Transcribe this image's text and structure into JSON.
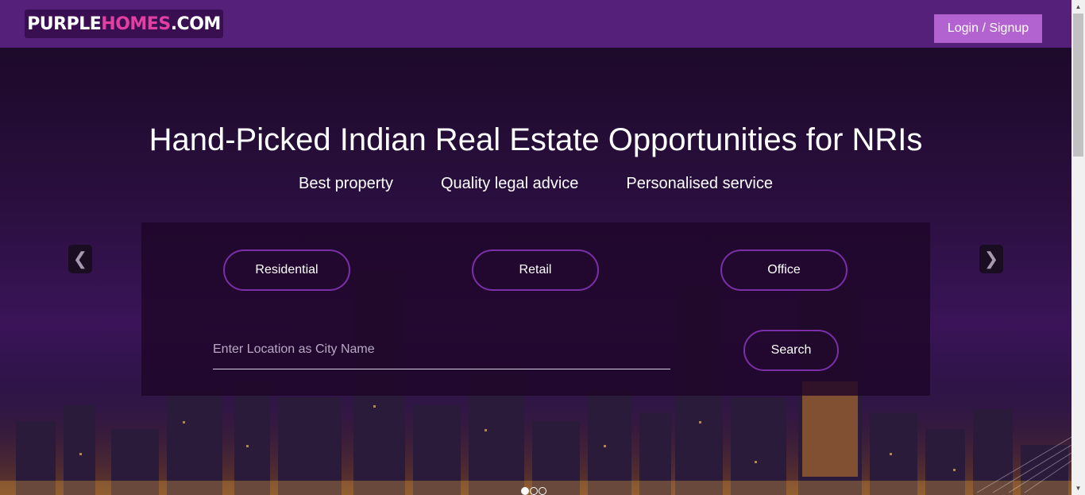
{
  "header": {
    "logo_part1": "PURPLE",
    "logo_part2": "HOMES",
    "logo_part3": ".COM",
    "login_label": "Login / Signup"
  },
  "hero": {
    "title": "Hand-Picked Indian Real Estate Opportunities for NRIs",
    "features": [
      "Best property",
      "Quality legal advice",
      "Personalised service"
    ]
  },
  "search": {
    "categories": [
      "Residential",
      "Retail",
      "Office"
    ],
    "location_placeholder": "Enter Location as City Name",
    "location_value": "",
    "search_label": "Search"
  },
  "carousel": {
    "prev_glyph": "❮",
    "next_glyph": "❯",
    "slide_count": 3,
    "active_slide": 1
  },
  "icons": {
    "prev": "chevron-left-icon",
    "next": "chevron-right-icon"
  },
  "colors": {
    "header_bg": "#55207a",
    "login_bg": "#b263cf",
    "pill_border": "#7a2fa8",
    "logo_accent": "#e23fa3"
  }
}
